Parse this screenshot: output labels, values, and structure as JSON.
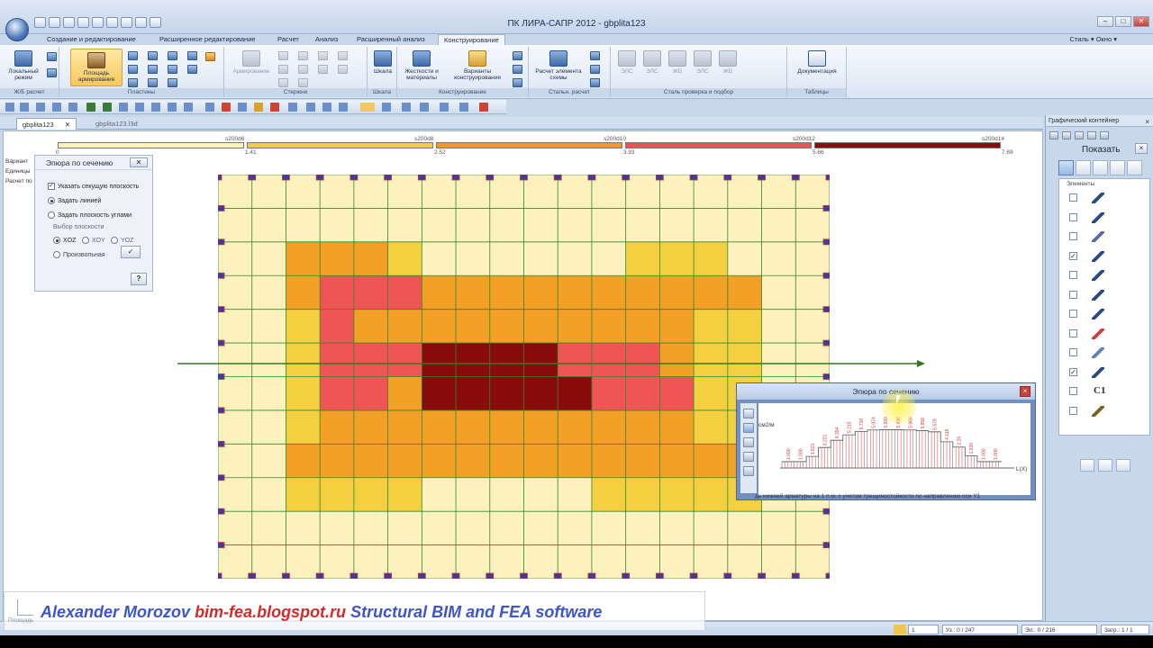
{
  "window": {
    "title": "ПК ЛИРА-САПР  2012 - gbplita123",
    "controls": [
      "–",
      "□",
      "✕"
    ]
  },
  "ribbon_tabs": [
    {
      "label": "Создание и редактирование",
      "active": false
    },
    {
      "label": "Расширенное редактирование",
      "active": false
    },
    {
      "label": "Расчет",
      "active": false
    },
    {
      "label": "Анализ",
      "active": false
    },
    {
      "label": "Расширенный анализ",
      "active": false
    },
    {
      "label": "Конструирование",
      "active": true
    }
  ],
  "style_menu": "Стиль  ▾  Окно  ▾",
  "ribbon": {
    "local_modes": "Локальный режим",
    "rebar_area": "Площадь армирования",
    "rebar_area_dis": "Армирование",
    "scale": "Шкала",
    "stiffness": "Жесткости и материалы",
    "design_variants": "Варианты конструирования",
    "calc_elem": "Расчет элемента схемы",
    "docs": "Документация",
    "steel_btns": [
      "ЭЛС",
      "ЭЛС",
      "ЖБ",
      "ЭЛС",
      "ЖБ"
    ],
    "groups": [
      "Ж/Б расчет",
      "Пластины",
      "Стержни",
      "Шкала",
      "Конструирование",
      "Стальн. расчет",
      "Сталь проверка и подбор",
      "Таблицы"
    ]
  },
  "doc_tabs": [
    {
      "label": "gbplita123",
      "active": true
    },
    {
      "label": "gbplita123.l3d",
      "active": false
    }
  ],
  "scale_bar": {
    "labels": [
      "s200d6",
      "s200d8",
      "s200d10",
      "s200d12",
      "s200d14"
    ],
    "values": [
      "0",
      "1.41",
      "2.52",
      "3.93",
      "5.66",
      "7.69"
    ],
    "colors": [
      "#fbf3b8",
      "#f2cd44",
      "#f29a28",
      "#ee5252",
      "#8a0d0d"
    ]
  },
  "info_lines": [
    "Вариант",
    "Единицы",
    "Расчет по"
  ],
  "rebar_map": {
    "cols": 18,
    "rows": 12,
    "palette": [
      "#fdf2bd",
      "#f4d040",
      "#f3a027",
      "#f05555",
      "#8a0b0b"
    ],
    "grid_color": "#2e8a2e",
    "node_color": "#3e3aa0",
    "cells": [
      "000000000000000000",
      "000000000000000000",
      "002221000000111000",
      "002333222222222200",
      "001322222222221100",
      "001333444433321100",
      "001332444443331100",
      "001222222222221100",
      "002222222222222200",
      "001111000001111100",
      "000000000000000000",
      "000000000000000000"
    ]
  },
  "section_dialog": {
    "title": "Эпюра по сечению",
    "close": "✕",
    "show_plane": "Указать секущую плоскость",
    "by_line": "Задать линией",
    "by_angles": "Задать плоскость углами",
    "plane_choice": "Выбор плоскости",
    "planes": [
      "XOZ",
      "XOY",
      "YOZ"
    ],
    "arbitrary": "Произвольная",
    "apply": "✓",
    "help": "?"
  },
  "diagram_window": {
    "title": "Эпюра по сечению",
    "close": "×",
    "y_unit": "см2/м",
    "x_label": "L(X)",
    "values": [
      "1.000",
      "1.000",
      "1.821",
      "3.221",
      "4.354",
      "5.215",
      "5.736",
      "5.974",
      "5.999",
      "5.996",
      "5.966",
      "5.858",
      "5.679",
      "4.118",
      "3.29",
      "1.930",
      "1.000",
      "1.000"
    ],
    "caption": "дь нижней арматуры на 1 п.м. с учетом трещиностойкости по направлению оси Y1"
  },
  "right_panel": {
    "header": "Графический контейнер",
    "close": "×",
    "show_title": "Показать",
    "show_close": "×",
    "elements_label": "Элементы",
    "rows": [
      {
        "checked": false,
        "text": ""
      },
      {
        "checked": false,
        "text": ""
      },
      {
        "checked": false,
        "text": ""
      },
      {
        "checked": true,
        "text": ""
      },
      {
        "checked": false,
        "text": ""
      },
      {
        "checked": false,
        "text": ""
      },
      {
        "checked": false,
        "text": ""
      },
      {
        "checked": false,
        "text": ""
      },
      {
        "checked": false,
        "text": ""
      },
      {
        "checked": true,
        "text": ""
      },
      {
        "checked": false,
        "text": "C1"
      },
      {
        "checked": false,
        "text": ""
      }
    ]
  },
  "statusbar": {
    "input": "1",
    "uz": "Уз.: 0 / 247",
    "el": "Эл.: 0 / 216",
    "load": "Загр.: 1 / 1"
  },
  "watermark": {
    "author": "Alexander Morozov",
    "link": "bim-fea.blogspot.ru",
    "tag": "Structural BIM and FEA software",
    "underlay": "Площадь"
  },
  "colors": {
    "accent": "#2e8a2e",
    "section_line": "#2f7a1f",
    "ribbon_active": "#f7c85a"
  }
}
